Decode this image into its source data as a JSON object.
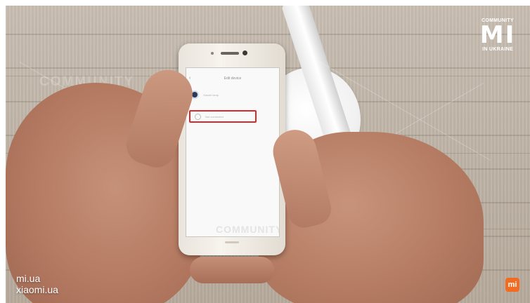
{
  "phone_screen": {
    "back_glyph": "‹",
    "title": "Edit device",
    "options": [
      {
        "label": "Xiaomi lamp",
        "icon": "device-icon"
      },
      {
        "label": "Not connected",
        "icon": "radio-icon",
        "highlighted": true
      }
    ],
    "footer_text": "",
    "watermark": "COMMUNITY"
  },
  "overlay": {
    "watermark_left": "COMMUNITY",
    "logo": {
      "top": "COMMUNITY",
      "mark": "MI",
      "bottom": "IN UKRAINE"
    },
    "sites": [
      "mi.ua",
      "xiaomi.ua"
    ],
    "badge": "mi"
  },
  "colors": {
    "highlight": "#d92a2a",
    "badge": "#f26b21"
  }
}
